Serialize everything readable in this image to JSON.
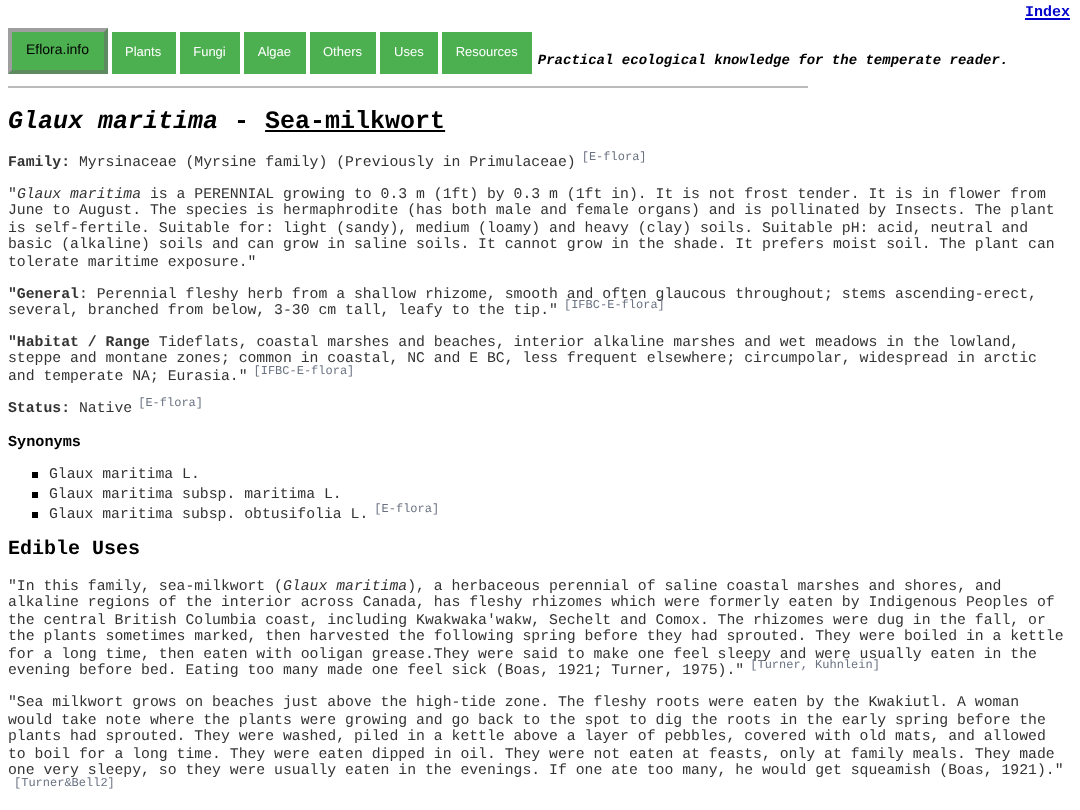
{
  "index_link": "Index",
  "nav": [
    {
      "label": "Eflora.info",
      "selected": true
    },
    {
      "label": "Plants",
      "selected": false
    },
    {
      "label": "Fungi",
      "selected": false
    },
    {
      "label": "Algae",
      "selected": false
    },
    {
      "label": "Others",
      "selected": false
    },
    {
      "label": "Uses",
      "selected": false
    },
    {
      "label": "Resources",
      "selected": false
    }
  ],
  "tagline": "Practical ecological knowledge for the temperate reader.",
  "title": {
    "scientific": "Glaux maritima",
    "separator": "-",
    "common": "Sea-milkwort"
  },
  "blocks": [
    {
      "kind": "para",
      "text": "**Family:** Myrsinaceae (Myrsine family) (Previously in Primulaceae)",
      "cite": "[E-flora]"
    },
    {
      "kind": "para",
      "text": "\"*Glaux maritima* is a PERENNIAL growing to 0.3 m (1ft) by 0.3 m (1ft in). It is not frost tender. It is in flower from June to August. The species is hermaphrodite (has both male and female organs) and is pollinated by Insects. The plant is self-fertile. Suitable for: light (sandy), medium (loamy) and heavy (clay) soils. Suitable pH: acid, neutral and basic (alkaline) soils and can grow in saline soils. It cannot grow in the shade. It prefers moist soil. The plant can tolerate maritime exposure.\""
    },
    {
      "kind": "para",
      "text": "**\"General**: Perennial fleshy herb from a shallow rhizome, smooth and often glaucous throughout; stems ascending-erect, several, branched from below, 3-30 cm tall, leafy to the tip.\"",
      "cite": "[IFBC-E-flora]"
    },
    {
      "kind": "para",
      "text": "**\"Habitat / Range** Tideflats, coastal marshes and beaches, interior alkaline marshes and wet meadows in the lowland, steppe and montane zones; common in coastal, NC and E BC, less frequent elsewhere; circumpolar, widespread in arctic and temperate NA; Eurasia.\"",
      "cite": "[IFBC-E-flora]"
    },
    {
      "kind": "para",
      "text": "**Status:** Native",
      "cite": "[E-flora]"
    },
    {
      "kind": "subheading",
      "text": "Synonyms"
    },
    {
      "kind": "list",
      "items": [
        {
          "text": "Glaux maritima L."
        },
        {
          "text": "Glaux maritima subsp. maritima L."
        },
        {
          "text": "Glaux maritima subsp. obtusifolia L.",
          "cite": "[E-flora]"
        }
      ]
    },
    {
      "kind": "heading",
      "text": "Edible Uses"
    },
    {
      "kind": "para",
      "text": "\"In this family, sea-milkwort (*Glaux maritima*), a herbaceous perennial of saline coastal marshes and shores, and alkaline regions of the interior across Canada, has fleshy rhizomes which were formerly eaten by Indigenous Peoples of the central British Columbia coast, including Kwakwaka'wakw, Sechelt and Comox. The rhizomes were dug in the fall, or the plants sometimes marked, then harvested the following spring before they had sprouted. They were boiled in a kettle for a long time, then eaten with ooligan grease.They were said to make one feel sleepy and were usually eaten in the evening before bed. Eating too many made one feel sick (Boas, 1921; Turner, 1975).\"",
      "cite": "[Turner, Kuhnlein]"
    },
    {
      "kind": "para",
      "text": "\"Sea milkwort grows on beaches just above the high-tide zone. The fleshy roots were eaten by the Kwakiutl. A woman would take note where the plants were growing and go back to the spot to dig the roots in the early spring before the plants had sprouted. They were washed, piled in a kettle above a layer of pebbles, covered with old mats, and allowed to boil for a long time. They were eaten dipped in oil. They were not eaten at feasts, only at family meals. They made one very sleepy, so they were usually eaten in the evenings. If one ate too many, he would get squeamish (Boas, 1921).\"",
      "cite": "[Turner&Bell2]"
    }
  ]
}
